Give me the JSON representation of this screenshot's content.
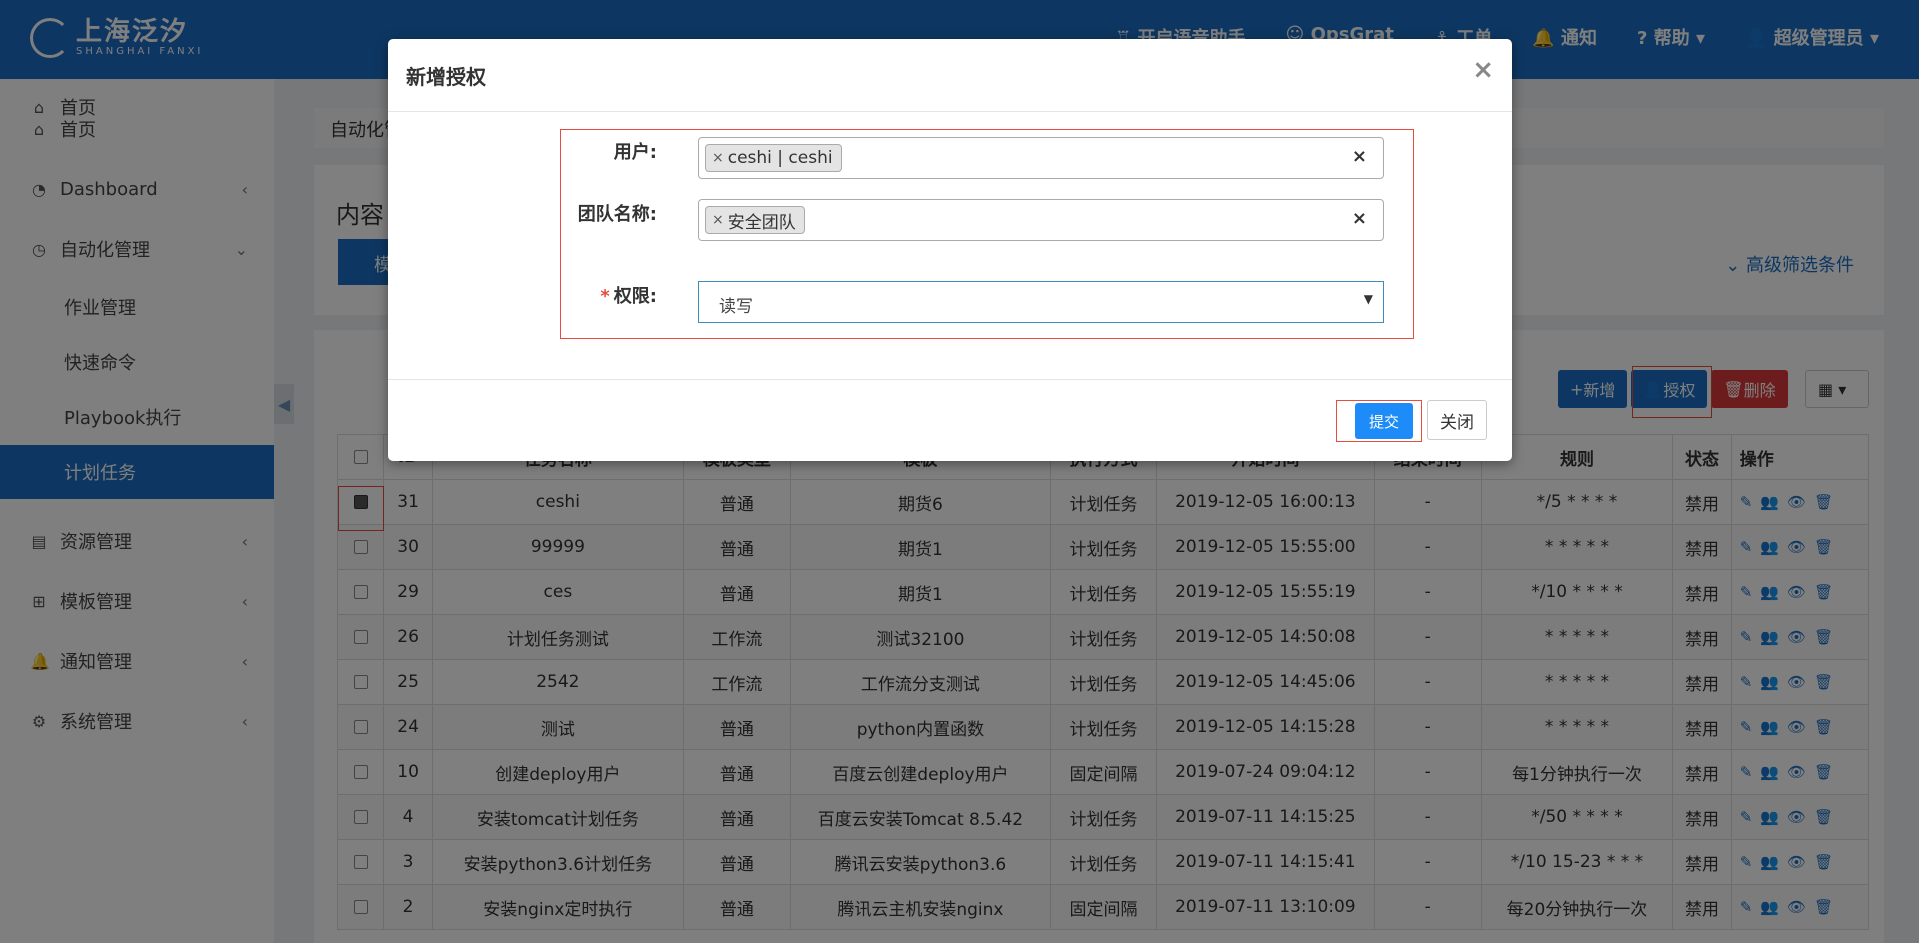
{
  "header": {
    "logo_cn": "上海泛汐",
    "logo_en": "SHANGHAI FANXI",
    "nav": [
      {
        "label": "开启语音助手",
        "icon": "bell-tower-icon"
      },
      {
        "label": "OpsGrat",
        "icon": "robot-icon"
      },
      {
        "label": "工单",
        "icon": "anchor-icon"
      },
      {
        "label": "通知",
        "icon": "bell-icon"
      },
      {
        "label": "帮助",
        "icon": "question-circle-icon"
      },
      {
        "label": "超级管理员",
        "icon": "user-icon"
      }
    ]
  },
  "sidebar": {
    "items": [
      {
        "label": "首页",
        "icon": "home-icon"
      },
      {
        "label": "Dashboard",
        "icon": "dashboard-icon"
      },
      {
        "label": "自动化管理",
        "icon": "clock-icon"
      },
      {
        "label": "资源管理",
        "icon": "book-icon"
      },
      {
        "label": "模板管理",
        "icon": "sitemap-icon"
      },
      {
        "label": "通知管理",
        "icon": "bell-icon"
      },
      {
        "label": "系统管理",
        "icon": "gear-icon"
      }
    ],
    "subitems": [
      "作业管理",
      "快速命令",
      "Playbook执行",
      "计划任务"
    ]
  },
  "main": {
    "breadcrumb": "自动化管",
    "content_title": "内容",
    "tab_label": "模",
    "advanced_filter": "高级筛选条件",
    "toolbar": {
      "add": "新增",
      "authorize": "授权",
      "delete": "删除"
    }
  },
  "table": {
    "headers": [
      "ID",
      "任务名称",
      "模板类型",
      "模板",
      "执行方式",
      "开始时间",
      "结束时间",
      "规则",
      "状态",
      "操作"
    ],
    "rows": [
      [
        "31",
        "ceshi",
        "普通",
        "期货6",
        "计划任务",
        "2019-12-05 16:00:13",
        "-",
        "*/5 * * * *",
        "禁用"
      ],
      [
        "30",
        "99999",
        "普通",
        "期货1",
        "计划任务",
        "2019-12-05 15:55:00",
        "-",
        "* * * * *",
        "禁用"
      ],
      [
        "29",
        "ces",
        "普通",
        "期货1",
        "计划任务",
        "2019-12-05 15:55:19",
        "-",
        "*/10 * * * *",
        "禁用"
      ],
      [
        "26",
        "计划任务测试",
        "工作流",
        "测试32100",
        "计划任务",
        "2019-12-05 14:50:08",
        "-",
        "* * * * *",
        "禁用"
      ],
      [
        "25",
        "2542",
        "工作流",
        "工作流分支测试",
        "计划任务",
        "2019-12-05 14:45:06",
        "-",
        "* * * * *",
        "禁用"
      ],
      [
        "24",
        "测试",
        "普通",
        "python内置函数",
        "计划任务",
        "2019-12-05 14:15:28",
        "-",
        "* * * * *",
        "禁用"
      ],
      [
        "10",
        "创建deploy用户",
        "普通",
        "百度云创建deploy用户",
        "固定间隔",
        "2019-07-24 09:04:12",
        "-",
        "每1分钟执行一次",
        "禁用"
      ],
      [
        "4",
        "安装tomcat计划任务",
        "普通",
        "百度云安装Tomcat 8.5.42",
        "计划任务",
        "2019-07-11 14:15:25",
        "-",
        "*/50 * * * *",
        "禁用"
      ],
      [
        "3",
        "安装python3.6计划任务",
        "普通",
        "腾讯云安装python3.6",
        "计划任务",
        "2019-07-11 14:15:41",
        "-",
        "*/10 15-23 * * *",
        "禁用"
      ],
      [
        "2",
        "安装nginx定时执行",
        "普通",
        "腾讯云主机安装nginx",
        "固定间隔",
        "2019-07-11 13:10:09",
        "-",
        "每20分钟执行一次",
        "禁用"
      ]
    ],
    "checked_row": 0
  },
  "modal": {
    "title": "新增授权",
    "user_label": "用户:",
    "user_tag": "ceshi | ceshi",
    "team_label": "团队名称:",
    "team_tag": "安全团队",
    "perm_label": "权限:",
    "perm_value": "读写",
    "submit": "提交",
    "close": "关闭"
  }
}
